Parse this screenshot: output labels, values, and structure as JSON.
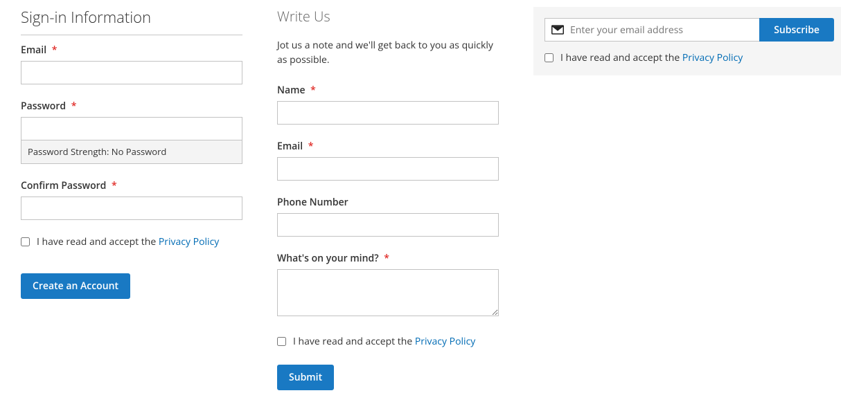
{
  "signin": {
    "title": "Sign-in Information",
    "email_label": "Email",
    "password_label": "Password",
    "pw_strength_label": "Password Strength:",
    "pw_strength_value": "No Password",
    "confirm_label": "Confirm Password",
    "accept_text": "I have read and accept the",
    "privacy_link": "Privacy Policy",
    "create_button": "Create an Account"
  },
  "writeus": {
    "title": "Write Us",
    "intro": "Jot us a note and we'll get back to you as quickly as possible.",
    "name_label": "Name",
    "email_label": "Email",
    "phone_label": "Phone Number",
    "mind_label": "What's on your mind?",
    "accept_text": "I have read and accept the",
    "privacy_link": "Privacy Policy",
    "submit_button": "Submit"
  },
  "newsletter": {
    "placeholder": "Enter your email address",
    "subscribe_button": "Subscribe",
    "accept_text": "I have read and accept the",
    "privacy_link": "Privacy Policy"
  },
  "required_mark": "*"
}
